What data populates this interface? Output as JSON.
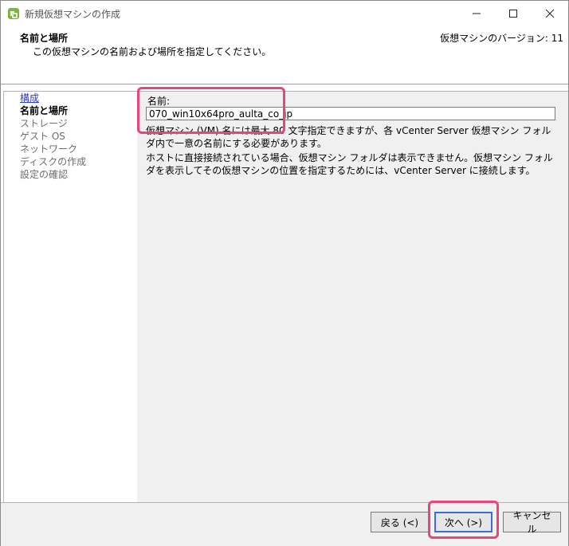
{
  "window": {
    "title": "新規仮想マシンの作成"
  },
  "header": {
    "title": "名前と場所",
    "subtitle": "この仮想マシンの名前および場所を指定してください。",
    "vm_version": "仮想マシンのバージョン: 11"
  },
  "nav": {
    "items": [
      {
        "label": "構成",
        "state": "link"
      },
      {
        "label": "名前と場所",
        "state": "current"
      },
      {
        "label": "ストレージ",
        "state": "disabled"
      },
      {
        "label": "ゲスト OS",
        "state": "disabled"
      },
      {
        "label": "ネットワーク",
        "state": "disabled"
      },
      {
        "label": "ディスクの作成",
        "state": "disabled"
      },
      {
        "label": "設定の確認",
        "state": "disabled"
      }
    ]
  },
  "form": {
    "name_label": "名前:",
    "name_value": "070_win10x64pro_aulta_co_jp",
    "help_text_1": "仮想マシン (VM) 名には最大 80 文字指定できますが、各 vCenter Server 仮想マシン フォルダ内で一意の名前にする必要があります。",
    "help_text_2": "ホストに直接接続されている場合、仮想マシン フォルダは表示できません。仮想マシン フォルダを表示してその仮想マシンの位置を指定するためには、vCenter Server に接続します。"
  },
  "buttons": {
    "back": "戻る (<)",
    "next": "次へ (>)",
    "cancel": "キャンセル"
  },
  "colors": {
    "highlight": "#e8467a",
    "link": "#2f3bc9",
    "panel_bg": "#f0f0f0"
  }
}
